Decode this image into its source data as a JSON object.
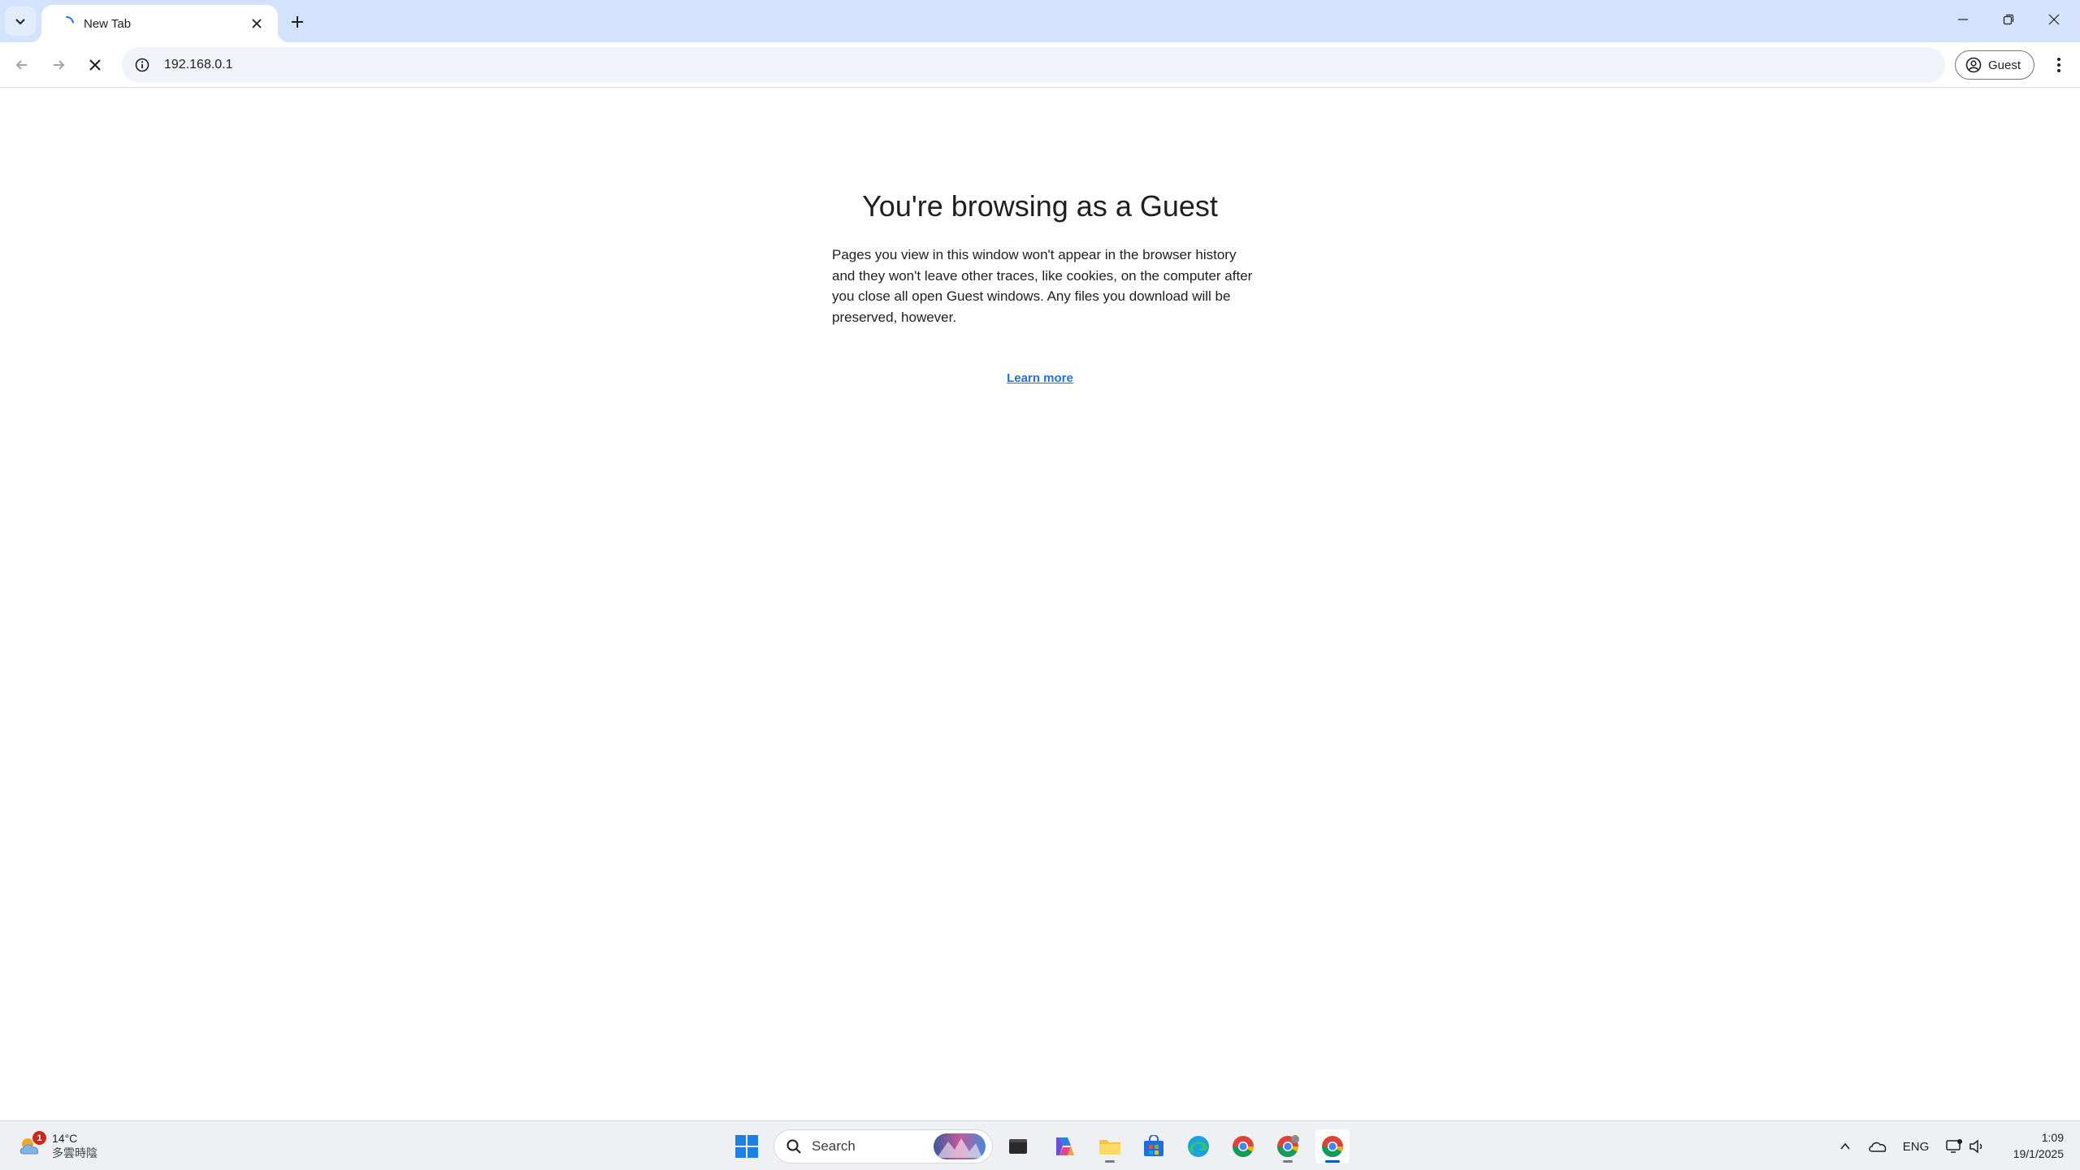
{
  "tab": {
    "title": "New Tab"
  },
  "toolbar": {
    "url": "192.168.0.1",
    "profile_label": "Guest"
  },
  "content": {
    "title": "You're browsing as a Guest",
    "body": "Pages you view in this window won't appear in the browser history and they won't leave other traces, like cookies, on the computer after you close all open Guest windows. Any files you download will be preserved, however.",
    "learn_more": "Learn more"
  },
  "taskbar": {
    "weather_temp": "14°C",
    "weather_condition": "多雲時陰",
    "weather_badge": "1",
    "search_placeholder": "Search",
    "language": "ENG",
    "time": "1:09",
    "date": "19/1/2025",
    "pinned_icons": [
      "windows-start-icon",
      "search-icon",
      "terminal-icon",
      "copilot-icon",
      "file-explorer-icon",
      "microsoft-store-icon",
      "edge-icon",
      "chrome-icon",
      "chrome-icon",
      "chrome-icon"
    ],
    "tray_icons": [
      "chevron-up-icon",
      "onedrive-icon",
      "network-icon",
      "volume-icon"
    ]
  },
  "colors": {
    "tabstrip": "#d3e3fd",
    "accent": "#1a73e8",
    "omnibox": "#f0f3f8"
  }
}
